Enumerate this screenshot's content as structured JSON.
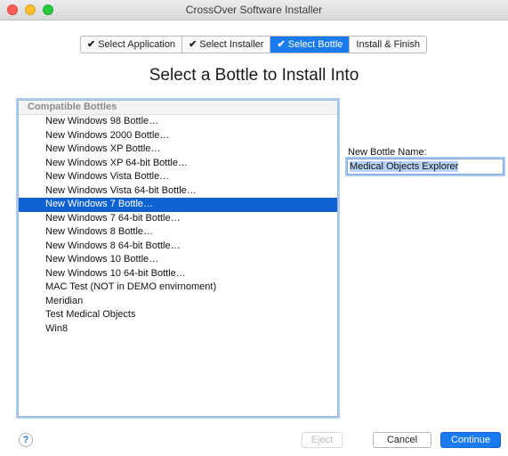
{
  "window": {
    "title": "CrossOver Software Installer"
  },
  "steps": [
    {
      "label": "Select Application",
      "check": "✔"
    },
    {
      "label": "Select Installer",
      "check": "✔"
    },
    {
      "label": "Select Bottle",
      "check": "✔"
    },
    {
      "label": "Install & Finish",
      "check": ""
    }
  ],
  "active_step": "Select Bottle",
  "heading": "Select a Bottle to Install Into",
  "bottles": {
    "header": "Compatible Bottles",
    "items": [
      "New Windows 98 Bottle…",
      "New Windows 2000 Bottle…",
      "New Windows XP Bottle…",
      "New Windows XP 64-bit Bottle…",
      "New Windows Vista Bottle…",
      "New Windows Vista 64-bit Bottle…",
      "New Windows 7 Bottle…",
      "New Windows 7 64-bit Bottle…",
      "New Windows 8 Bottle…",
      "New Windows 8 64-bit Bottle…",
      "New Windows 10 Bottle…",
      "New Windows 10 64-bit Bottle…",
      "MAC Test (NOT in DEMO envirnoment)",
      "Meridian",
      "Test Medical Objects",
      "Win8"
    ],
    "selected": "New Windows 7 Bottle…"
  },
  "new_bottle": {
    "label": "New Bottle Name:",
    "value": "Medical Objects Explorer"
  },
  "buttons": {
    "help": "?",
    "eject": "Eject",
    "cancel": "Cancel",
    "continue": "Continue"
  },
  "colors": {
    "accent": "#1a7bf0",
    "selection": "#0f63d1"
  }
}
